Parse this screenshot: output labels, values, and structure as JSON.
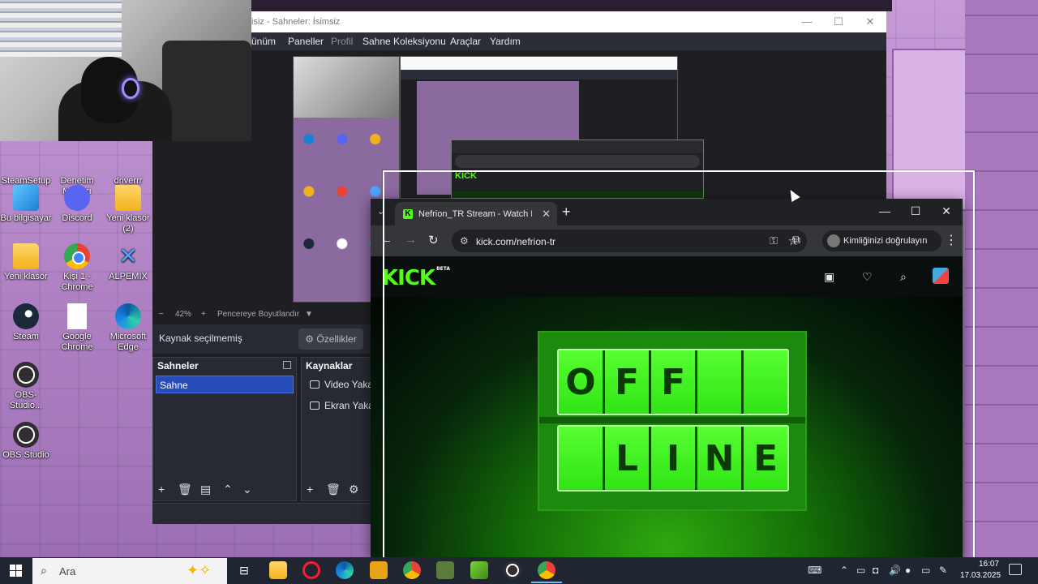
{
  "desktop_icons": [
    {
      "label": "SteamSetup\n(1)",
      "icon": "steam-setup-icon"
    },
    {
      "label": "Denetim\nMasası",
      "icon": "control-panel-icon"
    },
    {
      "label": "driverrr",
      "icon": "folder-icon"
    },
    {
      "label": "Bu bilgisayar",
      "icon": "this-pc-icon"
    },
    {
      "label": "Discord",
      "icon": "discord-icon"
    },
    {
      "label": "Yeni klasör\n(2)",
      "icon": "folder-icon"
    },
    {
      "label": "Yeni klasör",
      "icon": "folder-icon"
    },
    {
      "label": "Kişi 1 -\nChrome",
      "icon": "chrome-icon"
    },
    {
      "label": "ALPEMIX",
      "icon": "alpemix-icon"
    },
    {
      "label": "Steam",
      "icon": "steam-icon"
    },
    {
      "label": "Google\nChrome",
      "icon": "document-icon"
    },
    {
      "label": "Microsoft\nEdge",
      "icon": "edge-icon"
    },
    {
      "label": "OBS-Studio...",
      "icon": "obs-icon"
    },
    {
      "label": "OBS Studio",
      "icon": "obs-icon"
    }
  ],
  "obs": {
    "title": "isiz - Sahneler: İsimsiz",
    "menu": [
      "ünüm",
      "Paneller",
      "Profil",
      "Sahne Koleksiyonu",
      "Araçlar",
      "Yardım"
    ],
    "zoom": {
      "minus": "−",
      "value": "42%",
      "plus": "+",
      "fit": "Pencereye Boyutlandır"
    },
    "no_source": "Kaynak seçilmemiş",
    "properties": "Özellikler",
    "scenes_title": "Sahneler",
    "scene_items": [
      "Sahne"
    ],
    "sources_title": "Kaynaklar",
    "source_items": [
      "Video Yakal",
      "Ekran Yakal"
    ]
  },
  "chrome": {
    "tab_title": "Nefrion_TR Stream - Watch Live",
    "url": "kick.com/nefrion-tr",
    "verify_label": "Kimliğinizi doğrulayın",
    "kick_logo": "KICK",
    "kick_beta": "BETA"
  },
  "offline_sign": {
    "top": [
      "O",
      "F",
      "F",
      "",
      ""
    ],
    "bottom": [
      "",
      "L",
      "I",
      "N",
      "E"
    ]
  },
  "taskbar": {
    "search_placeholder": "Ara",
    "time": "16:07",
    "date": "17.03.2025"
  }
}
